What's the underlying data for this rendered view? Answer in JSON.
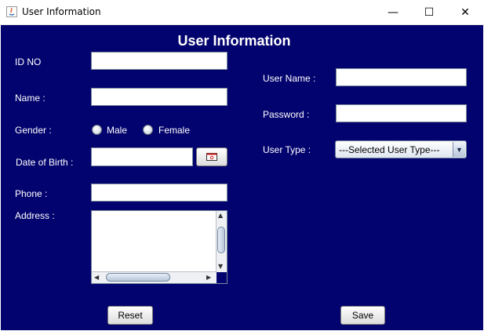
{
  "window": {
    "title": "User Information",
    "controls": {
      "minimize": "—",
      "maximize": "☐",
      "close": "✕"
    }
  },
  "form": {
    "heading": "User Information",
    "left": {
      "id_label": "ID NO",
      "name_label": "Name :",
      "gender_label": "Gender :",
      "gender_options": [
        "Male",
        "Female"
      ],
      "dob_label": "Date of Birth :",
      "phone_label": "Phone :",
      "address_label": "Address :"
    },
    "right": {
      "username_label": "User Name :",
      "password_label": "Password :",
      "usertype_label": "User Type :",
      "usertype_selected": "---Selected User Type---"
    },
    "values": {
      "id": "",
      "name": "",
      "dob": "",
      "phone": "",
      "address": "",
      "username": "",
      "password": ""
    },
    "buttons": {
      "reset": "Reset",
      "save": "Save"
    }
  },
  "colors": {
    "panel_bg": "#03036f",
    "label_text": "#ffffff"
  }
}
